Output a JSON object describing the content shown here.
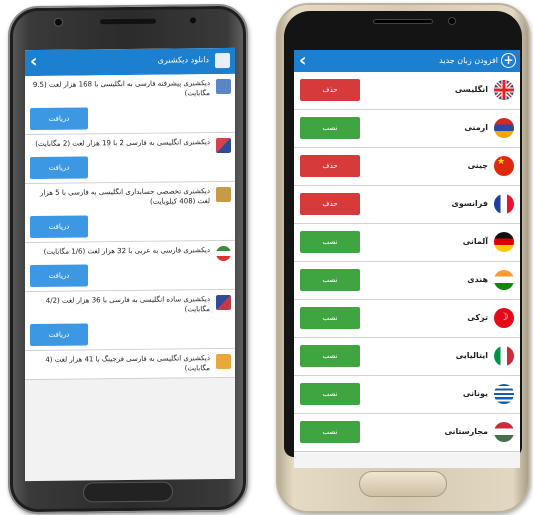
{
  "left_app": {
    "title": "دانلود دیکشنری",
    "items": [
      {
        "text": "دیکشنری پیشرفته فارسی به انگلیسی با 168 هزار لغت (9.5 مگابایت)",
        "button": "دریافت",
        "thumb_color": "#5a86c8"
      },
      {
        "text": "دیکشنری انگلیسی به فارسی 2 با 19 هزار لغت (2 مگابایت)",
        "button": "دریافت",
        "thumb_color": "#d8404b"
      },
      {
        "text": "دیکشنری تخصصی حسابداری انگلیسی به فارسی با 5 هزار لغت (408 کیلوبایت)",
        "button": "دریافت",
        "thumb_color": "#c99a45"
      },
      {
        "text": "دیکشنری فارسی به عربی با 32 هزار لغت (1/6 مگابایت)",
        "button": "دریافت",
        "thumb_color": "#3b8a3b"
      },
      {
        "text": "دیکشنری ساده انگلیسی به فارسی با 36 هزار لغت (4/2 مگابایت)",
        "button": "دریافت",
        "thumb_color": "#c33a47"
      },
      {
        "text": "دیکشنری انگلیسی به فارسی فرجینگ با 41 هزار لغت (4 مگابایت)",
        "button": "دریافت",
        "thumb_color": "#e8a83a"
      }
    ]
  },
  "right_app": {
    "title": "افزودن زبان جدید",
    "languages": [
      {
        "name": "انگلیسی",
        "action": "حذف",
        "state": "delete",
        "flag": "uk-flag-icon"
      },
      {
        "name": "ارمنی",
        "action": "نصب",
        "state": "install",
        "flag": "armenia-flag-icon"
      },
      {
        "name": "چینی",
        "action": "حذف",
        "state": "delete",
        "flag": "china-flag-icon"
      },
      {
        "name": "فرانسوی",
        "action": "حذف",
        "state": "delete",
        "flag": "france-flag-icon"
      },
      {
        "name": "آلمانی",
        "action": "نصب",
        "state": "install",
        "flag": "germany-flag-icon"
      },
      {
        "name": "هندی",
        "action": "نصب",
        "state": "install",
        "flag": "india-flag-icon"
      },
      {
        "name": "ترکی",
        "action": "نصب",
        "state": "install",
        "flag": "turkey-flag-icon"
      },
      {
        "name": "ایتالیایی",
        "action": "نصب",
        "state": "install",
        "flag": "italy-flag-icon"
      },
      {
        "name": "یونانی",
        "action": "نصب",
        "state": "install",
        "flag": "greece-flag-icon"
      },
      {
        "name": "مجارستانی",
        "action": "نصب",
        "state": "install",
        "flag": "hungary-flag-icon"
      }
    ]
  },
  "colors": {
    "appbar": "#1c7fd0",
    "download_button": "#3d98e4",
    "delete": "#d63a3a",
    "install": "#3fa540"
  }
}
